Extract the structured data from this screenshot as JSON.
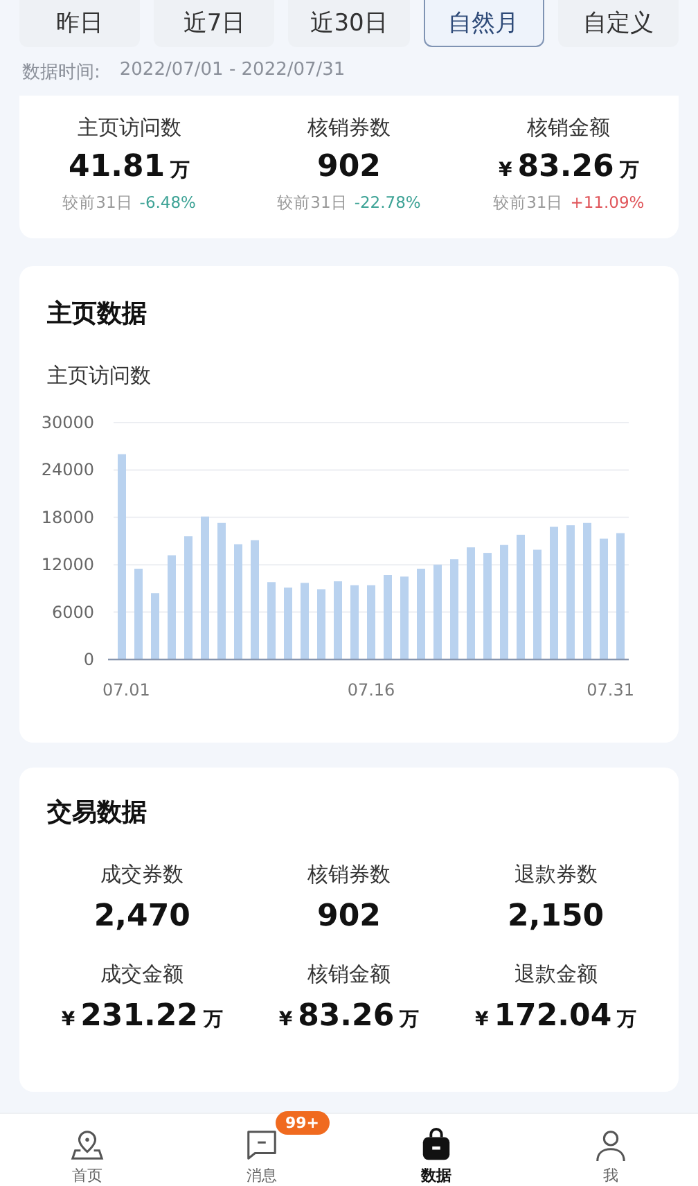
{
  "range_tabs": [
    {
      "label": "昨日",
      "selected": false
    },
    {
      "label": "近7日",
      "selected": false
    },
    {
      "label": "近30日",
      "selected": false
    },
    {
      "label": "自然月",
      "selected": true
    },
    {
      "label": "自定义",
      "selected": false
    }
  ],
  "data_time": {
    "label": "数据时间:",
    "value": "2022/07/01 - 2022/07/31"
  },
  "summary": [
    {
      "label": "主页访问数",
      "value": "41.81",
      "unit": "万",
      "compare_label": "较前31日",
      "change": "-6.48%",
      "color": "#3ea396"
    },
    {
      "label": "核销券数",
      "value": "902",
      "compare_label": "较前31日",
      "change": "-22.78%",
      "color": "#3ea396"
    },
    {
      "label": "核销金额",
      "prefix": "¥",
      "value": "83.26",
      "unit": "万",
      "compare_label": "较前31日",
      "change": "+11.09%",
      "color": "#e0555a"
    }
  ],
  "homepage_data": {
    "title": "主页数据",
    "subtitle": "主页访问数",
    "chart_data": {
      "type": "bar",
      "categories": [
        "07.01",
        null,
        null,
        null,
        null,
        null,
        null,
        null,
        null,
        null,
        null,
        null,
        null,
        null,
        null,
        "07.16",
        null,
        null,
        null,
        null,
        null,
        null,
        null,
        null,
        null,
        null,
        null,
        null,
        null,
        null,
        "07.31"
      ],
      "series": [
        {
          "color": "#b9d2ef",
          "values": [
            26000,
            11500,
            8400,
            13200,
            15600,
            18100,
            17300,
            14600,
            15100,
            9800,
            9100,
            9700,
            8900,
            9900,
            9400,
            9400,
            10700,
            10500,
            11500,
            12000,
            12700,
            14200,
            13500,
            14500,
            15800,
            13900,
            16800,
            17000,
            17300,
            15300,
            16000
          ]
        }
      ],
      "ylim": [
        0,
        30000
      ],
      "yticks": [
        0,
        6000,
        12000,
        18000,
        24000,
        30000
      ],
      "grid": true
    }
  },
  "trade_data": {
    "title": "交易数据",
    "items": [
      {
        "label": "成交券数",
        "value": "2,470"
      },
      {
        "label": "核销券数",
        "value": "902"
      },
      {
        "label": "退款券数",
        "value": "2,150"
      },
      {
        "label": "成交金额",
        "prefix": "¥",
        "value": "231.22",
        "unit": "万"
      },
      {
        "label": "核销金额",
        "prefix": "¥",
        "value": "83.26",
        "unit": "万"
      },
      {
        "label": "退款金额",
        "prefix": "¥",
        "value": "172.04",
        "unit": "万"
      }
    ]
  },
  "bottom_nav": [
    {
      "kind": "pin",
      "label": "首页",
      "selected": false
    },
    {
      "kind": "message",
      "label": "消息",
      "selected": false,
      "badge": "99+"
    },
    {
      "kind": "bag",
      "label": "数据",
      "selected": true
    },
    {
      "kind": "person",
      "label": "我",
      "selected": false
    }
  ]
}
